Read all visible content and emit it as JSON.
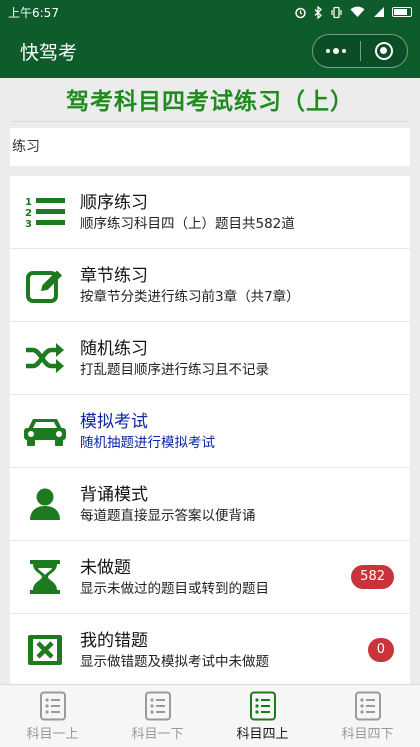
{
  "status_bar": {
    "time": "上午6:57"
  },
  "nav": {
    "title": "快驾考"
  },
  "headline": "驾考科目四考试练习（上）",
  "section_label": "练习",
  "items": [
    {
      "title": "顺序练习",
      "desc": "顺序练习科目四（上）题目共582道",
      "icon": "numbered-list-icon"
    },
    {
      "title": "章节练习",
      "desc": "按章节分类进行练习前3章（共7章）",
      "icon": "edit-icon"
    },
    {
      "title": "随机练习",
      "desc": "打乱题目顺序进行练习且不记录",
      "icon": "shuffle-icon"
    },
    {
      "title": "模拟考试",
      "desc": "随机抽题进行模拟考试",
      "icon": "car-icon"
    },
    {
      "title": "背诵模式",
      "desc": "每道题直接显示答案以便背诵",
      "icon": "user-icon"
    },
    {
      "title": "未做题",
      "desc": "显示未做过的题目或转到的题目",
      "icon": "hourglass-icon",
      "badge": "582"
    },
    {
      "title": "我的错题",
      "desc": "显示做错题及模拟考试中未做题",
      "icon": "error-box-icon",
      "badge": "0"
    }
  ],
  "tabs": [
    {
      "label": "科目一上",
      "active": false
    },
    {
      "label": "科目一下",
      "active": false
    },
    {
      "label": "科目四上",
      "active": true
    },
    {
      "label": "科目四下",
      "active": false
    }
  ],
  "colors": {
    "primary": "#0e5b2b",
    "accent_green": "#1f8b1f",
    "highlight_blue": "#0d27a3",
    "badge_red": "#c8343a"
  }
}
